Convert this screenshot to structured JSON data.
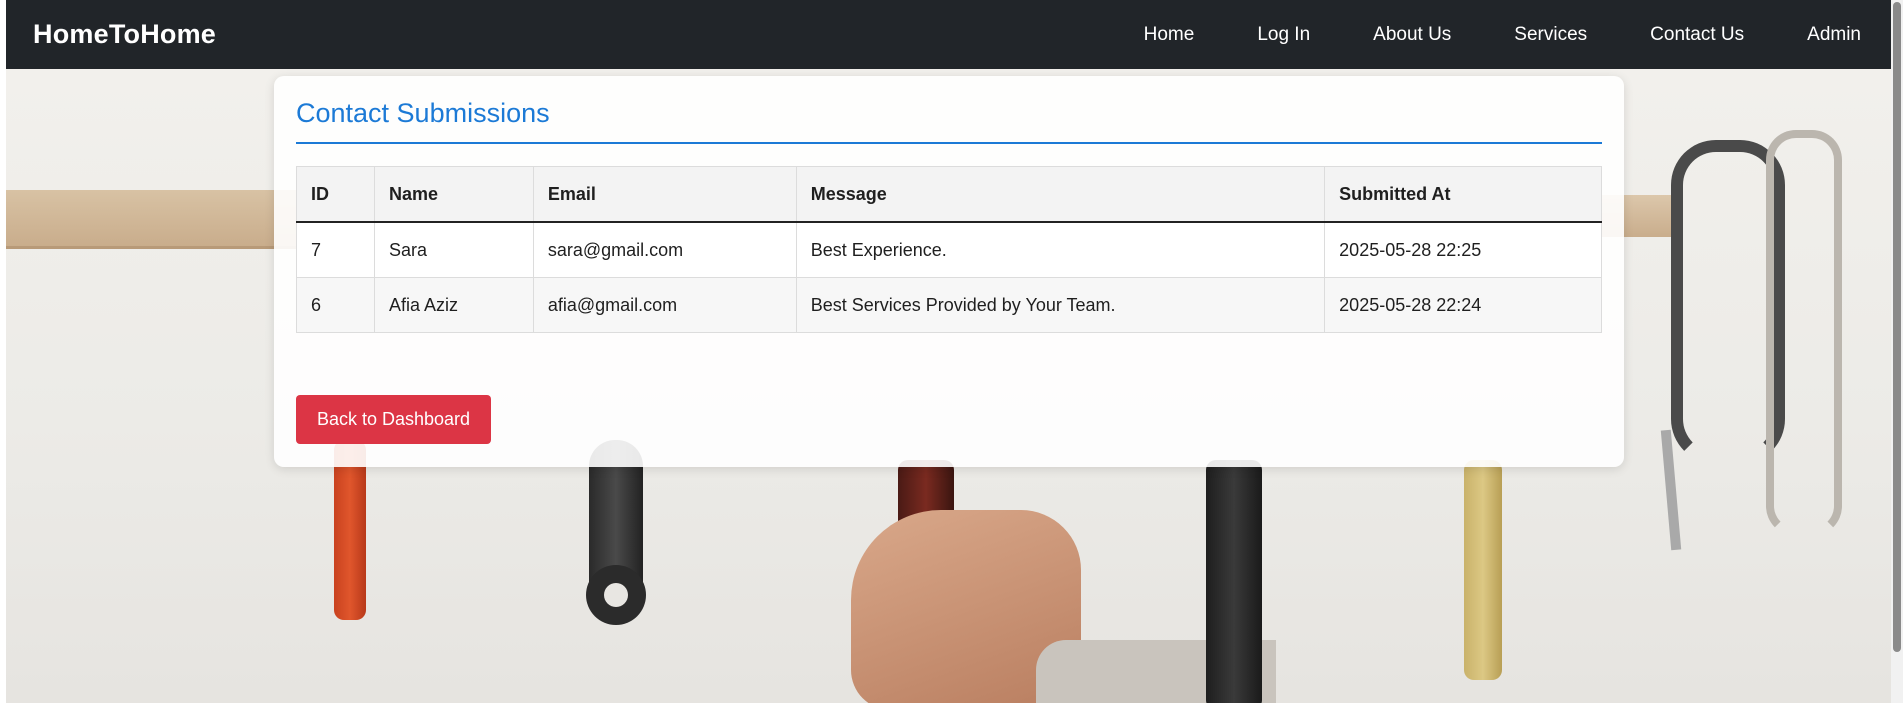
{
  "navbar": {
    "brand": "HomeToHome",
    "links": [
      "Home",
      "Log In",
      "About Us",
      "Services",
      "Contact Us",
      "Admin"
    ]
  },
  "card": {
    "title": "Contact Submissions",
    "columns": [
      "ID",
      "Name",
      "Email",
      "Message",
      "Submitted At"
    ],
    "rows": [
      [
        "7",
        "Sara",
        "sara@gmail.com",
        "Best Experience.",
        "2025-05-28 22:25"
      ],
      [
        "6",
        "Afia Aziz",
        "afia@gmail.com",
        "Best Services Provided by Your Team.",
        "2025-05-28 22:24"
      ]
    ],
    "back_button": "Back to Dashboard"
  },
  "colors": {
    "navbar_bg": "#212529",
    "title_accent": "#1c7ad6",
    "button_bg": "#dc3545"
  }
}
